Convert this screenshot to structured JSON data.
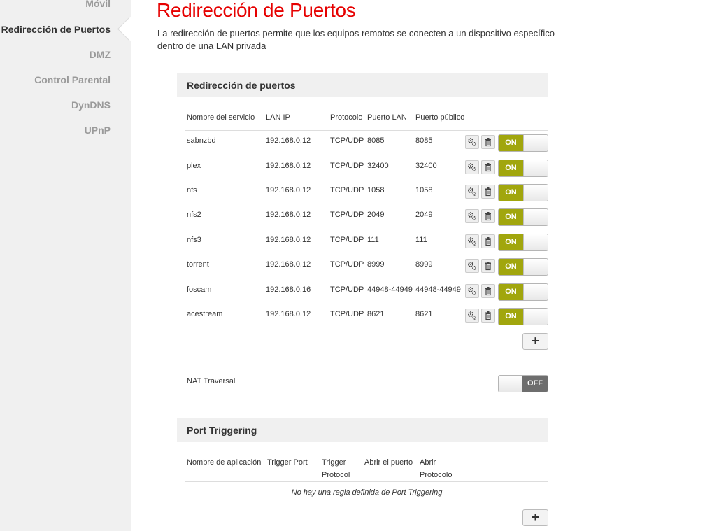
{
  "sidebar": {
    "items": [
      {
        "label": "Móvil"
      },
      {
        "label": "Redirección de Puertos"
      },
      {
        "label": "DMZ"
      },
      {
        "label": "Control Parental"
      },
      {
        "label": "DynDNS"
      },
      {
        "label": "UPnP"
      }
    ],
    "active": "Redirección de Puertos"
  },
  "page": {
    "title": "Redirección de Puertos",
    "description": "La redirección de puertos permite que los equipos remotos se conecten a un dispositivo específico dentro de una LAN privada"
  },
  "port_forwarding": {
    "title": "Redirección de puertos",
    "columns": {
      "service": "Nombre del servicio",
      "lan_ip": "LAN IP",
      "protocol": "Protocolo",
      "lan_port": "Puerto LAN",
      "public_port": "Puerto público"
    },
    "rows": [
      {
        "service": "sabnzbd",
        "lan_ip": "192.168.0.12",
        "protocol": "TCP/UDP",
        "lan_port": "8085",
        "public_port": "8085",
        "state": "ON"
      },
      {
        "service": "plex",
        "lan_ip": "192.168.0.12",
        "protocol": "TCP/UDP",
        "lan_port": "32400",
        "public_port": "32400",
        "state": "ON"
      },
      {
        "service": "nfs",
        "lan_ip": "192.168.0.12",
        "protocol": "TCP/UDP",
        "lan_port": "1058",
        "public_port": "1058",
        "state": "ON"
      },
      {
        "service": "nfs2",
        "lan_ip": "192.168.0.12",
        "protocol": "TCP/UDP",
        "lan_port": "2049",
        "public_port": "2049",
        "state": "ON"
      },
      {
        "service": "nfs3",
        "lan_ip": "192.168.0.12",
        "protocol": "TCP/UDP",
        "lan_port": "111",
        "public_port": "111",
        "state": "ON"
      },
      {
        "service": "torrent",
        "lan_ip": "192.168.0.12",
        "protocol": "TCP/UDP",
        "lan_port": "8999",
        "public_port": "8999",
        "state": "ON"
      },
      {
        "service": "foscam",
        "lan_ip": "192.168.0.16",
        "protocol": "TCP/UDP",
        "lan_port": "44948-44949",
        "public_port": "44948-44949",
        "state": "ON"
      },
      {
        "service": "acestream",
        "lan_ip": "192.168.0.12",
        "protocol": "TCP/UDP",
        "lan_port": "8621",
        "public_port": "8621",
        "state": "ON"
      }
    ],
    "add_label": "+",
    "icons": {
      "edit": "gears-icon",
      "delete": "trash-icon"
    }
  },
  "nat_traversal": {
    "label": "NAT Traversal",
    "state": "OFF"
  },
  "port_triggering": {
    "title": "Port Triggering",
    "columns": {
      "app_name": "Nombre de aplicación",
      "trigger_port": "Trigger Port",
      "trigger_protocol_line1": "Trigger",
      "trigger_protocol_line2": "Protocol",
      "open_port": "Abrir el puerto",
      "open_protocol_line1": "Abrir",
      "open_protocol_line2": "Protocolo"
    },
    "empty_message": "No hay una regla definida de Port Triggering",
    "add_label": "+"
  },
  "colors": {
    "accent_red": "#e60000",
    "toggle_on": "#a1a60d",
    "toggle_off": "#6e6e6e",
    "sidebar_bg": "#f0f0f0"
  }
}
